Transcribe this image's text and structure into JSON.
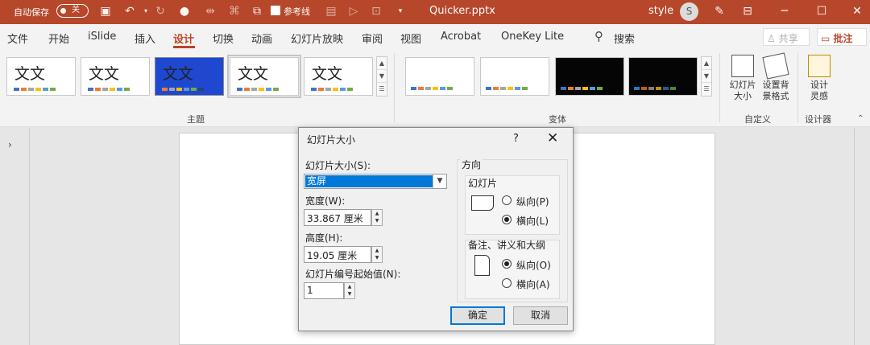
{
  "titlebar": {
    "autosave_label": "自动保存",
    "autosave_toggle": "关",
    "reference_line_label": "参考线",
    "doc_title": "Quicker.pptx",
    "user_name": "style",
    "avatar_letter": "S",
    "accent": "#b7472a"
  },
  "menu": {
    "items": [
      "文件",
      "开始",
      "iSlide",
      "插入",
      "设计",
      "切换",
      "动画",
      "幻灯片放映",
      "审阅",
      "视图",
      "Acrobat",
      "OneKey Lite"
    ],
    "active": "设计",
    "search_label": "搜索",
    "share_label": "共享",
    "comment_label": "批注"
  },
  "ribbon": {
    "theme_thumb_text": "文文",
    "themes_group_label": "主题",
    "variants_group_label": "变体",
    "customize_group_label": "自定义",
    "designer_group_label": "设计器",
    "slide_size_label_1": "幻灯片",
    "slide_size_label_2": "大小",
    "format_bg_label_1": "设置背",
    "format_bg_label_2": "景格式",
    "design_ideas_label_1": "设计",
    "design_ideas_label_2": "灵感"
  },
  "dialog": {
    "title": "幻灯片大小",
    "help_glyph": "?",
    "close_glyph": "✕",
    "size_label": "幻灯片大小(S):",
    "size_value": "宽屏",
    "width_label": "宽度(W):",
    "width_value": "33.867 厘米",
    "height_label": "高度(H):",
    "height_value": "19.05 厘米",
    "numbering_label": "幻灯片编号起始值(N):",
    "numbering_value": "1",
    "orientation_label": "方向",
    "slides_label": "幻灯片",
    "slides_portrait": "纵向(P)",
    "slides_landscape": "横向(L)",
    "notes_label": "备注、讲义和大纲",
    "notes_portrait": "纵向(O)",
    "notes_landscape": "横向(A)",
    "ok_label": "确定",
    "cancel_label": "取消"
  }
}
